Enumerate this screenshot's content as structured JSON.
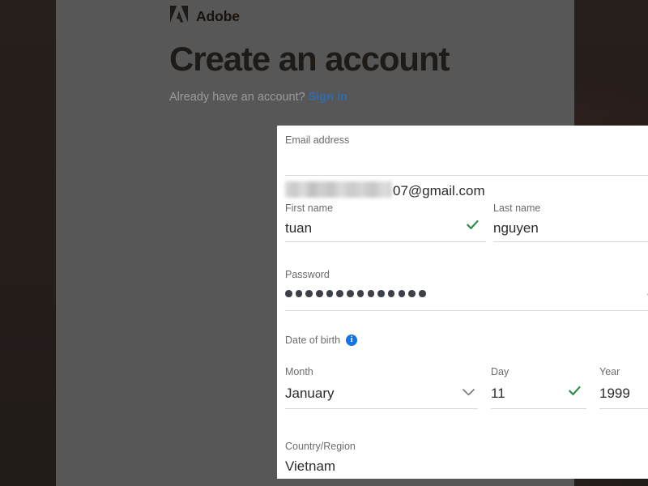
{
  "brand": {
    "logo_icon": "adobe-logo-icon",
    "name": "Adobe"
  },
  "header": {
    "title": "Create an account",
    "signin_prompt": "Already have an account?",
    "signin_link": "Sign in"
  },
  "colors": {
    "backdrop": "#241d1a",
    "scrim": "#575757",
    "card": "#ffffff",
    "link": "#2f6cae",
    "valid_check": "#2d8a47",
    "info_badge": "#1473e6",
    "label_text": "#6b6b6b",
    "value_text": "#2c2c2c",
    "underline": "#d8d8d8"
  },
  "form": {
    "email": {
      "label": "Email address",
      "redacted_prefix": true,
      "value_visible": "07@gmail.com",
      "valid_icon": "check-icon"
    },
    "first_name": {
      "label": "First name",
      "value": "tuan",
      "valid_icon": "check-icon"
    },
    "last_name": {
      "label": "Last name",
      "value": "nguyen",
      "valid_icon": "check-icon"
    },
    "password": {
      "label": "Password",
      "masked_char_count": 14,
      "toggle_icon": "eye-off-icon",
      "valid_icon": "check-icon"
    },
    "date_of_birth": {
      "label": "Date of birth",
      "info_icon": "info-icon",
      "month": {
        "label": "Month",
        "value": "January",
        "dropdown_icon": "chevron-down-icon"
      },
      "day": {
        "label": "Day",
        "value": "11",
        "valid_icon": "check-icon"
      },
      "year": {
        "label": "Year",
        "value": "1999",
        "valid_icon": "check-icon"
      }
    },
    "country": {
      "label": "Country/Region",
      "value": "Vietnam",
      "dropdown_icon": "chevron-down-icon"
    }
  }
}
